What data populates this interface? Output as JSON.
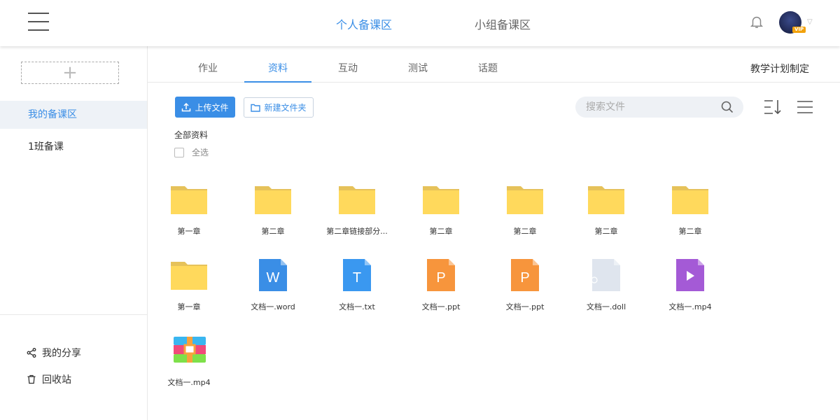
{
  "header": {
    "tabs": [
      {
        "label": "个人备课区",
        "active": true
      },
      {
        "label": "小组备课区",
        "active": false
      }
    ],
    "vip_badge": "VIP"
  },
  "sidebar": {
    "items": [
      {
        "label": "我的备课区",
        "active": true
      },
      {
        "label": "1班备课",
        "active": false
      }
    ],
    "share_label": "我的分享",
    "trash_label": "回收站"
  },
  "tabs": [
    {
      "label": "作业",
      "active": false
    },
    {
      "label": "资料",
      "active": true
    },
    {
      "label": "互动",
      "active": false
    },
    {
      "label": "测试",
      "active": false
    },
    {
      "label": "话题",
      "active": false
    }
  ],
  "plan_link": "教学计划制定",
  "toolbar": {
    "upload_label": "上传文件",
    "new_folder_label": "新建文件夹",
    "search_placeholder": "搜索文件"
  },
  "breadcrumb": "全部资料",
  "select_all_label": "全选",
  "files": [
    {
      "name": "第一章",
      "type": "folder"
    },
    {
      "name": "第二章",
      "type": "folder"
    },
    {
      "name": "第二章链接部分...",
      "type": "folder"
    },
    {
      "name": "第二章",
      "type": "folder"
    },
    {
      "name": "第二章",
      "type": "folder"
    },
    {
      "name": "第二章",
      "type": "folder"
    },
    {
      "name": "第二章",
      "type": "folder"
    },
    {
      "name": "第一章",
      "type": "folder"
    },
    {
      "name": "文档一.word",
      "type": "word",
      "letter": "W"
    },
    {
      "name": "文档一.txt",
      "type": "txt",
      "letter": "T"
    },
    {
      "name": "文档一.ppt",
      "type": "ppt",
      "letter": "P"
    },
    {
      "name": "文档一.ppt",
      "type": "ppt",
      "letter": "P"
    },
    {
      "name": "文档一.doll",
      "type": "unknown"
    },
    {
      "name": "文档一.mp4",
      "type": "video"
    },
    {
      "name": "文档一.mp4",
      "type": "archive"
    }
  ],
  "colors": {
    "accent": "#3a8ee6",
    "folder": "#ffd95c",
    "folder_tab": "#e6c25a",
    "word": "#3a8ee6",
    "txt": "#3a98f0",
    "ppt": "#f7953c",
    "unknown": "#dfe5ee",
    "video": "#a45ad6"
  }
}
